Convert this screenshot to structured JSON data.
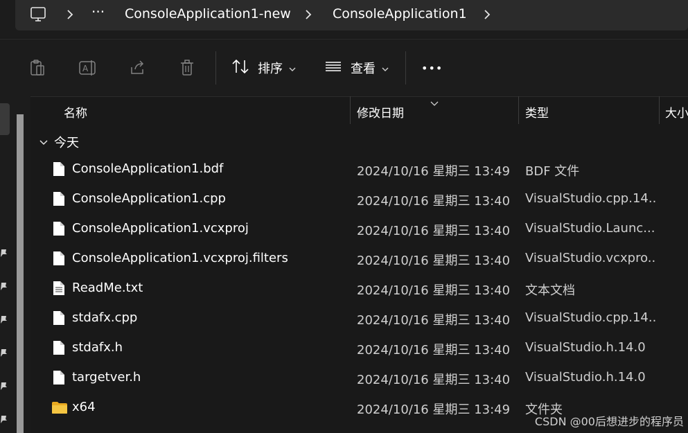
{
  "address_bar": {
    "crumbs": [
      "ConsoleApplication1-new",
      "ConsoleApplication1"
    ],
    "overflow": "···"
  },
  "toolbar": {
    "sort_label": "排序",
    "view_label": "查看",
    "more_label": "•••"
  },
  "columns": {
    "name": "名称",
    "date": "修改日期",
    "type": "类型",
    "size": "大小"
  },
  "group": {
    "label": "今天"
  },
  "files": [
    {
      "name": "ConsoleApplication1.bdf",
      "date": "2024/10/16 星期三 13:49",
      "type": "BDF 文件",
      "icon": "file-icon"
    },
    {
      "name": "ConsoleApplication1.cpp",
      "date": "2024/10/16 星期三 13:40",
      "type": "VisualStudio.cpp.14...",
      "icon": "file-icon"
    },
    {
      "name": "ConsoleApplication1.vcxproj",
      "date": "2024/10/16 星期三 13:40",
      "type": "VisualStudio.Launc...",
      "icon": "file-icon"
    },
    {
      "name": "ConsoleApplication1.vcxproj.filters",
      "date": "2024/10/16 星期三 13:40",
      "type": "VisualStudio.vcxpro...",
      "icon": "file-icon"
    },
    {
      "name": "ReadMe.txt",
      "date": "2024/10/16 星期三 13:40",
      "type": "文本文档",
      "icon": "text-file-icon"
    },
    {
      "name": "stdafx.cpp",
      "date": "2024/10/16 星期三 13:40",
      "type": "VisualStudio.cpp.14...",
      "icon": "file-icon"
    },
    {
      "name": "stdafx.h",
      "date": "2024/10/16 星期三 13:40",
      "type": "VisualStudio.h.14.0",
      "icon": "file-icon"
    },
    {
      "name": "targetver.h",
      "date": "2024/10/16 星期三 13:40",
      "type": "VisualStudio.h.14.0",
      "icon": "file-icon"
    },
    {
      "name": "x64",
      "date": "2024/10/16 星期三 13:49",
      "type": "文件夹",
      "icon": "folder-icon"
    }
  ],
  "watermark": "CSDN @00后想进步的程序员",
  "colors": {
    "background": "#191919",
    "folder": "#f4c542",
    "text": "#ffffff",
    "secondary_text": "#cfcfcf"
  }
}
